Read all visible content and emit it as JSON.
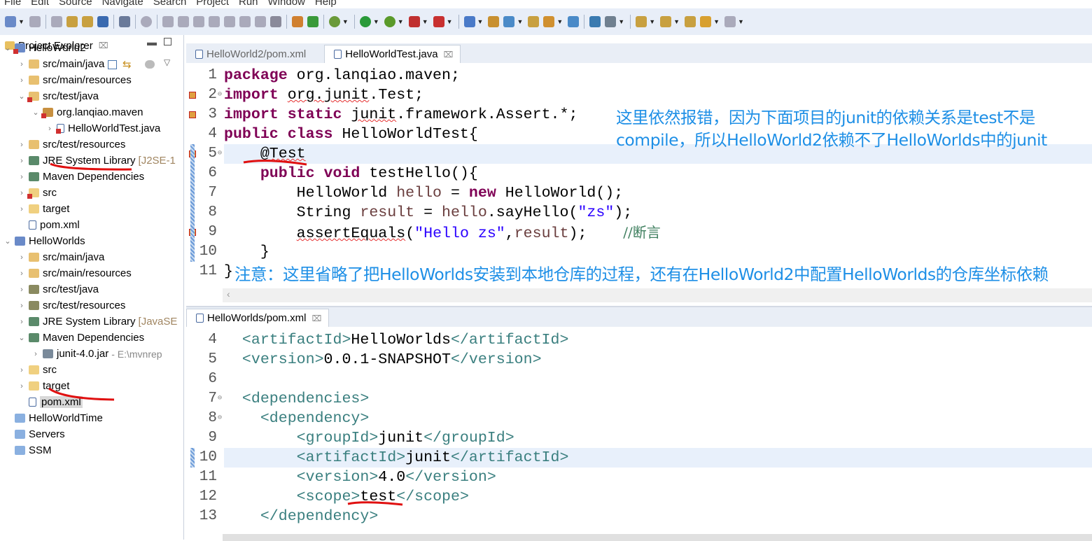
{
  "menu": [
    "File",
    "Edit",
    "Source",
    "Navigate",
    "Search",
    "Project",
    "Run",
    "Window",
    "Help"
  ],
  "toolbar_icons": [
    "new-icon",
    "save-icon",
    "save-all-icon",
    "build-icon",
    "publish-icon",
    "console-icon",
    "skip-breakpoints-icon",
    "resume-icon",
    "suspend-icon",
    "terminate-icon",
    "disconnect-icon",
    "step-into-icon",
    "step-over-icon",
    "step-return-icon",
    "drop-frame-icon",
    "use-step-filters-icon",
    "spring-icon",
    "ai-icon",
    "debug-icon",
    "run-icon",
    "run-coverage-icon",
    "external-tools-icon",
    "server-icon",
    "new-java-project-icon",
    "new-package-icon",
    "new-class-icon",
    "open-type-icon",
    "open-folder-icon",
    "search-icon",
    "globe-icon",
    "pin-icon",
    "next-annotation-icon",
    "prev-annotation-icon",
    "last-edit-icon",
    "back-icon",
    "forward-icon"
  ],
  "explorer": {
    "title": "Project Explorer",
    "close": "⌧",
    "items": [
      {
        "label": "HelloWorld2",
        "depth": 0,
        "arrow": "⌄",
        "icon": "maven-project-error"
      },
      {
        "label": "src/main/java",
        "depth": 1,
        "arrow": "›",
        "icon": "source-folder"
      },
      {
        "label": "src/main/resources",
        "depth": 1,
        "arrow": "›",
        "icon": "source-folder"
      },
      {
        "label": "src/test/java",
        "depth": 1,
        "arrow": "⌄",
        "icon": "source-folder-error"
      },
      {
        "label": "org.lanqiao.maven",
        "depth": 2,
        "arrow": "⌄",
        "icon": "package-error"
      },
      {
        "label": "HelloWorldTest.java",
        "depth": 3,
        "arrow": "›",
        "icon": "java-file-error"
      },
      {
        "label": "src/test/resources",
        "depth": 1,
        "arrow": "›",
        "icon": "source-folder"
      },
      {
        "label": "JRE System Library",
        "deco": "[J2SE-1",
        "depth": 1,
        "arrow": "›",
        "icon": "library"
      },
      {
        "label": "Maven Dependencies",
        "depth": 1,
        "arrow": "›",
        "icon": "library"
      },
      {
        "label": "src",
        "depth": 1,
        "arrow": "›",
        "icon": "folder-error"
      },
      {
        "label": "target",
        "depth": 1,
        "arrow": "›",
        "icon": "folder"
      },
      {
        "label": "pom.xml",
        "depth": 1,
        "arrow": "",
        "icon": "maven-file"
      },
      {
        "label": "HelloWorlds",
        "depth": 0,
        "arrow": "⌄",
        "icon": "maven-project"
      },
      {
        "label": "src/main/java",
        "depth": 1,
        "arrow": "›",
        "icon": "source-folder"
      },
      {
        "label": "src/main/resources",
        "depth": 1,
        "arrow": "›",
        "icon": "source-folder"
      },
      {
        "label": "src/test/java",
        "depth": 1,
        "arrow": "›",
        "icon": "source-folder-test"
      },
      {
        "label": "src/test/resources",
        "depth": 1,
        "arrow": "›",
        "icon": "source-folder-test"
      },
      {
        "label": "JRE System Library",
        "deco": "[JavaSE",
        "depth": 1,
        "arrow": "›",
        "icon": "library"
      },
      {
        "label": "Maven Dependencies",
        "depth": 1,
        "arrow": "⌄",
        "icon": "library"
      },
      {
        "label": "junit-4.0.jar",
        "gray": "- E:\\mvnrep",
        "depth": 2,
        "arrow": "›",
        "icon": "jar"
      },
      {
        "label": "src",
        "depth": 1,
        "arrow": "›",
        "icon": "folder"
      },
      {
        "label": "target",
        "depth": 1,
        "arrow": "›",
        "icon": "folder"
      },
      {
        "label": "pom.xml",
        "depth": 1,
        "arrow": "",
        "icon": "maven-file",
        "selected": true
      },
      {
        "label": "HelloWorldTime",
        "depth": 0,
        "arrow": "",
        "icon": "closed-project"
      },
      {
        "label": "Servers",
        "depth": 0,
        "arrow": "",
        "icon": "closed-project"
      },
      {
        "label": "SSM",
        "depth": 0,
        "arrow": "",
        "icon": "closed-project"
      }
    ]
  },
  "top_editor": {
    "tabs": [
      {
        "label": "HelloWorld2/pom.xml",
        "active": false
      },
      {
        "label": "HelloWorldTest.java",
        "active": true,
        "close": "⌧"
      }
    ],
    "lines": [
      {
        "n": "1",
        "t": [
          {
            "c": "kw",
            "s": "package"
          },
          {
            "c": "",
            "s": " org.lanqiao.maven;"
          }
        ]
      },
      {
        "n": "2",
        "fold": true,
        "marker": true,
        "t": [
          {
            "c": "kw",
            "s": "import"
          },
          {
            "c": "",
            "s": " "
          },
          {
            "c": "err",
            "s": "org.junit"
          },
          {
            "c": "",
            "s": ".Test;"
          }
        ]
      },
      {
        "n": "3",
        "marker": true,
        "t": [
          {
            "c": "kw",
            "s": "import static"
          },
          {
            "c": "",
            "s": " "
          },
          {
            "c": "err",
            "s": "junit"
          },
          {
            "c": "",
            "s": ".framework.Assert.*;"
          }
        ]
      },
      {
        "n": "4",
        "t": [
          {
            "c": "kw",
            "s": "public class"
          },
          {
            "c": "",
            "s": " HelloWorldTest{"
          }
        ]
      },
      {
        "n": "5",
        "fold": true,
        "marker": true,
        "hl": true,
        "t": [
          {
            "c": "",
            "s": "    @"
          },
          {
            "c": "err",
            "s": "Test"
          }
        ]
      },
      {
        "n": "6",
        "t": [
          {
            "c": "",
            "s": "    "
          },
          {
            "c": "kw",
            "s": "public void"
          },
          {
            "c": "",
            "s": " testHello(){"
          }
        ]
      },
      {
        "n": "7",
        "t": [
          {
            "c": "",
            "s": "        HelloWorld "
          },
          {
            "c": "var",
            "s": "hello"
          },
          {
            "c": "",
            "s": " = "
          },
          {
            "c": "kw",
            "s": "new"
          },
          {
            "c": "",
            "s": " HelloWorld();"
          }
        ]
      },
      {
        "n": "8",
        "t": [
          {
            "c": "",
            "s": "        String "
          },
          {
            "c": "var",
            "s": "result"
          },
          {
            "c": "",
            "s": " = "
          },
          {
            "c": "var",
            "s": "hello"
          },
          {
            "c": "",
            "s": ".sayHello("
          },
          {
            "c": "str",
            "s": "\"zs\""
          },
          {
            "c": "",
            "s": ");"
          }
        ]
      },
      {
        "n": "9",
        "marker": true,
        "t": [
          {
            "c": "",
            "s": "        "
          },
          {
            "c": "err",
            "s": "assertEquals"
          },
          {
            "c": "",
            "s": "("
          },
          {
            "c": "str",
            "s": "\"Hello zs\""
          },
          {
            "c": "",
            "s": ","
          },
          {
            "c": "var",
            "s": "result"
          },
          {
            "c": "",
            "s": ");    "
          },
          {
            "c": "cm",
            "s": "//断言"
          }
        ]
      },
      {
        "n": "10",
        "t": [
          {
            "c": "",
            "s": "    }"
          }
        ]
      },
      {
        "n": "11",
        "t": [
          {
            "c": "",
            "s": "}"
          }
        ]
      }
    ]
  },
  "annotations": {
    "top_note": "这里依然报错，因为下面项目的junit的依赖关系是test不是compile，所以HelloWorld2依赖不了HelloWorlds中的junit",
    "bottom_note": "注意：这里省略了把HelloWorlds安装到本地仓库的过程，还有在HelloWorld2中配置HelloWorlds的仓库坐标依赖"
  },
  "bottom_editor": {
    "tabs": [
      {
        "label": "HelloWorlds/pom.xml",
        "active": true,
        "close": "⌧"
      }
    ],
    "lines": [
      {
        "n": "4",
        "t": [
          {
            "c": "tag",
            "s": "  <artifactId>"
          },
          {
            "c": "",
            "s": "HelloWorlds"
          },
          {
            "c": "tag",
            "s": "</artifactId>"
          }
        ]
      },
      {
        "n": "5",
        "t": [
          {
            "c": "tag",
            "s": "  <version>"
          },
          {
            "c": "",
            "s": "0.0.1-SNAPSHOT"
          },
          {
            "c": "tag",
            "s": "</version>"
          }
        ]
      },
      {
        "n": "6",
        "t": []
      },
      {
        "n": "7",
        "fold": true,
        "t": [
          {
            "c": "tag",
            "s": "  <dependencies>"
          }
        ]
      },
      {
        "n": "8",
        "fold": true,
        "t": [
          {
            "c": "tag",
            "s": "    <dependency>"
          }
        ]
      },
      {
        "n": "9",
        "t": [
          {
            "c": "tag",
            "s": "        <groupId>"
          },
          {
            "c": "",
            "s": "junit"
          },
          {
            "c": "tag",
            "s": "</groupId>"
          }
        ]
      },
      {
        "n": "10",
        "hl": true,
        "t": [
          {
            "c": "tag",
            "s": "        <artifactId>"
          },
          {
            "c": "",
            "s": "junit"
          },
          {
            "c": "tag",
            "s": "</artifactId>"
          }
        ]
      },
      {
        "n": "11",
        "t": [
          {
            "c": "tag",
            "s": "        <version>"
          },
          {
            "c": "",
            "s": "4.0"
          },
          {
            "c": "tag",
            "s": "</version>"
          }
        ]
      },
      {
        "n": "12",
        "t": [
          {
            "c": "tag",
            "s": "        <scope>"
          },
          {
            "c": "",
            "s": "test"
          },
          {
            "c": "tag",
            "s": "</scope>"
          }
        ]
      },
      {
        "n": "13",
        "t": [
          {
            "c": "tag",
            "s": "    </dependency>"
          }
        ]
      }
    ]
  },
  "colors": {
    "annotation": "#1e8fe6",
    "keyword": "#7f0055",
    "string": "#2a00ff",
    "xml_tag": "#3a7f7f",
    "red_mark": "#e01010"
  }
}
